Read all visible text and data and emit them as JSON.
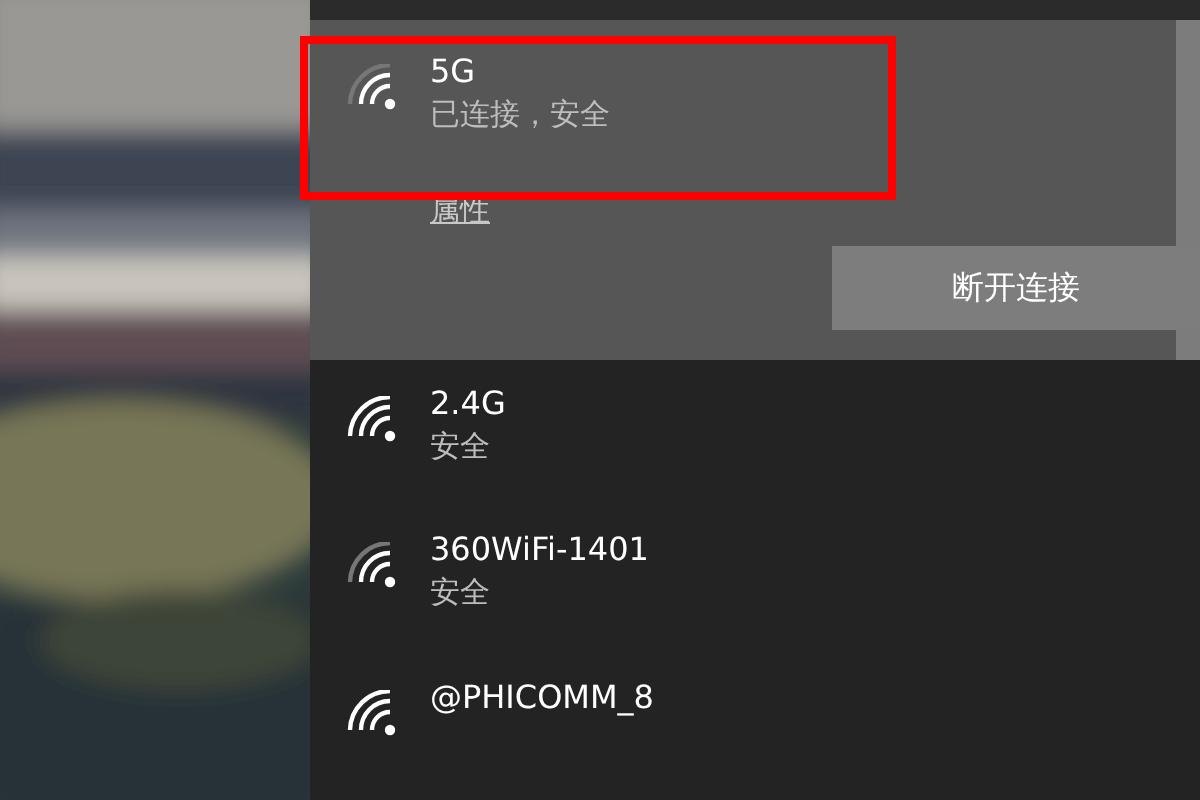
{
  "networks": [
    {
      "name": "5G",
      "status": "已连接，安全",
      "kind": "weak",
      "expanded": true,
      "highlighted": true,
      "link": "属性",
      "action": "断开连接"
    },
    {
      "name": "2.4G",
      "status": "安全",
      "kind": "strong",
      "expanded": false,
      "highlighted": false
    },
    {
      "name": "360WiFi-1401",
      "status": "安全",
      "kind": "weak",
      "expanded": false,
      "highlighted": false
    },
    {
      "name": "@PHICOMM_8",
      "kind": "strong",
      "expanded": false,
      "highlighted": false
    }
  ]
}
